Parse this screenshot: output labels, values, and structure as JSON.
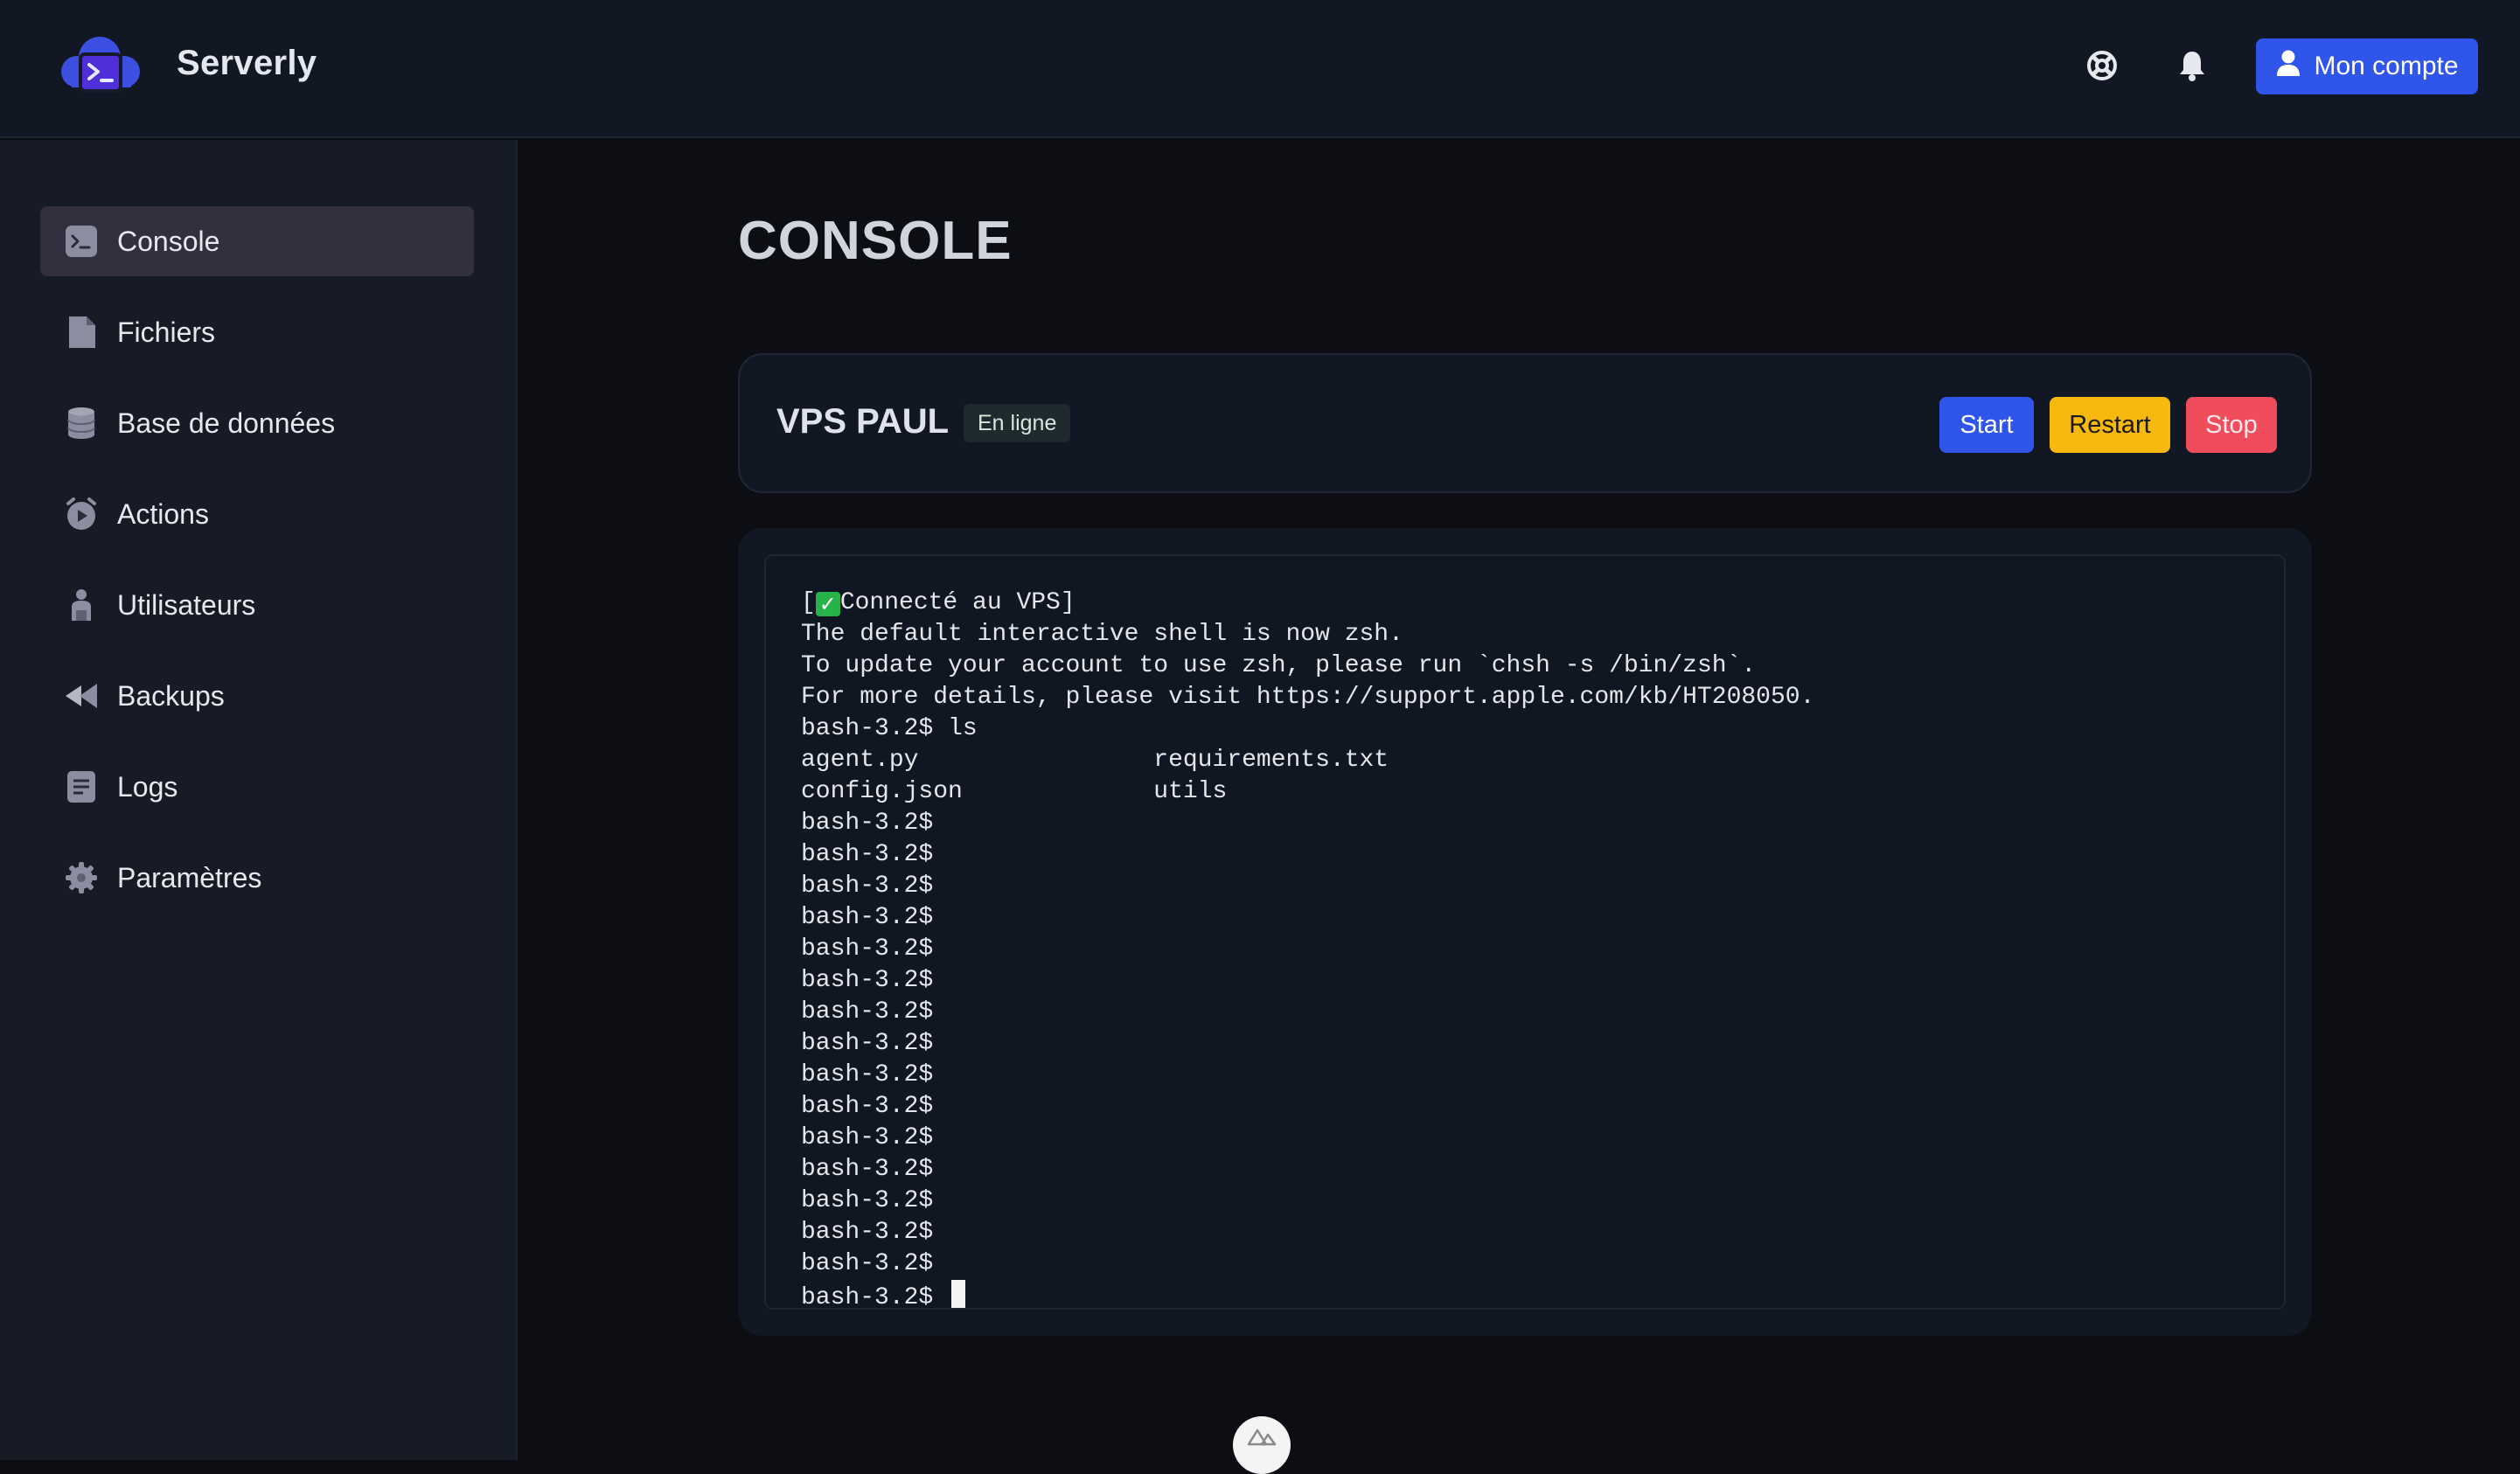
{
  "app": {
    "brand": "Serverly"
  },
  "header": {
    "account_label": "Mon compte",
    "icons": [
      "help-lifebuoy-icon",
      "bell-icon",
      "user-icon"
    ]
  },
  "sidebar": {
    "items": [
      {
        "label": "Console",
        "icon": "terminal-icon",
        "active": true
      },
      {
        "label": "Fichiers",
        "icon": "file-icon",
        "active": false
      },
      {
        "label": "Base de données",
        "icon": "database-icon",
        "active": false
      },
      {
        "label": "Actions",
        "icon": "clock-play-icon",
        "active": false
      },
      {
        "label": "Utilisateurs",
        "icon": "user-icon",
        "active": false
      },
      {
        "label": "Backups",
        "icon": "rewind-icon",
        "active": false
      },
      {
        "label": "Logs",
        "icon": "document-lines-icon",
        "active": false
      },
      {
        "label": "Paramètres",
        "icon": "gear-icon",
        "active": false
      }
    ]
  },
  "page": {
    "title": "CONSOLE"
  },
  "server": {
    "name": "VPS PAUL",
    "status": "En ligne",
    "start_label": "Start",
    "restart_label": "Restart",
    "stop_label": "Stop"
  },
  "terminal": {
    "connect_prefix": "[",
    "connect_text": "Connecté au VPS]",
    "lines": [
      "The default interactive shell is now zsh.",
      "To update your account to use zsh, please run `chsh -s /bin/zsh`.",
      "For more details, please visit https://support.apple.com/kb/HT208050.",
      "bash-3.2$ ls",
      "agent.py                requirements.txt",
      "config.json             utils",
      "bash-3.2$",
      "bash-3.2$",
      "bash-3.2$",
      "bash-3.2$",
      "bash-3.2$",
      "bash-3.2$",
      "bash-3.2$",
      "bash-3.2$",
      "bash-3.2$",
      "bash-3.2$",
      "bash-3.2$",
      "bash-3.2$",
      "bash-3.2$",
      "bash-3.2$",
      "bash-3.2$"
    ],
    "prompt": "bash-3.2$ "
  },
  "colors": {
    "accent": "#2f55ea",
    "restart": "#f7b90f",
    "stop": "#ef4d5c",
    "background": "#0c0e13",
    "surface": "#111723"
  }
}
